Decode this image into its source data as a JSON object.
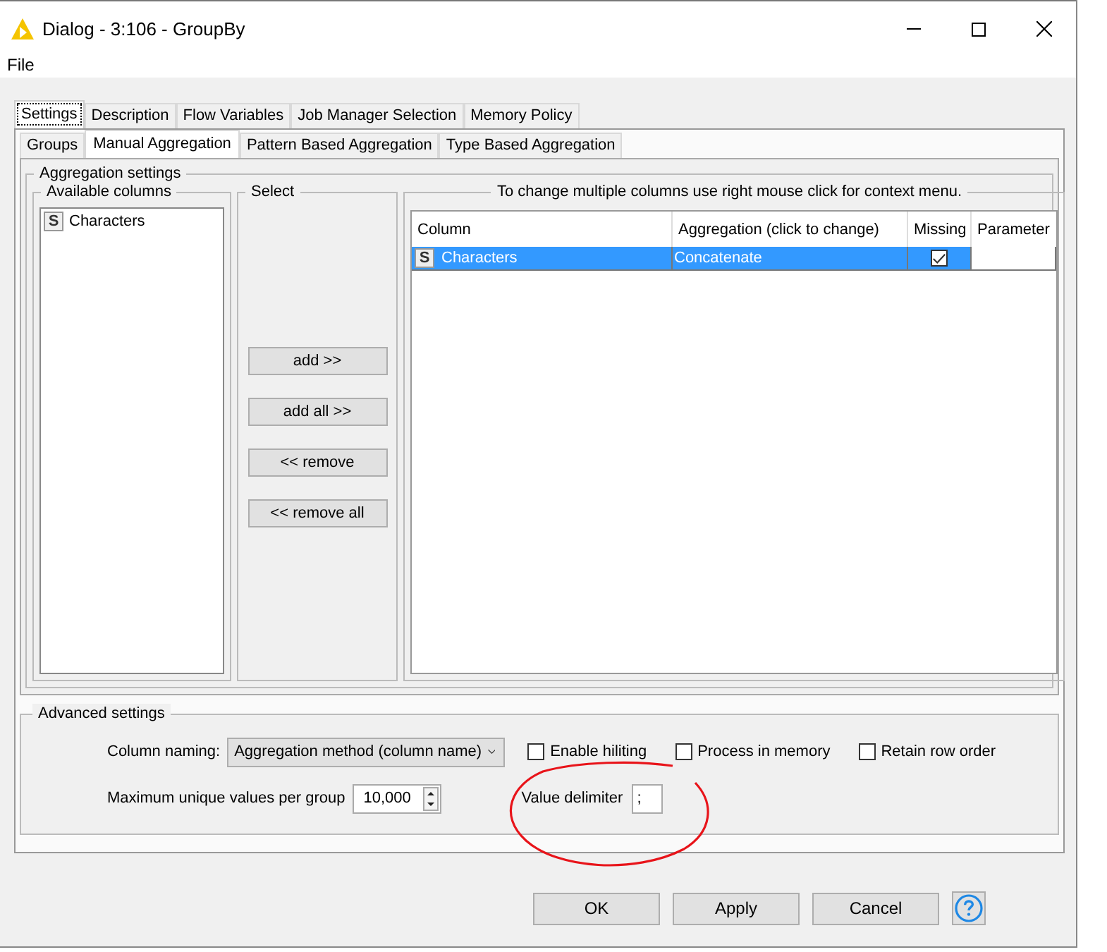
{
  "window": {
    "title": "Dialog - 3:106 - GroupBy"
  },
  "menu": [
    "File"
  ],
  "tabs": [
    {
      "label": "Settings",
      "selected": true
    },
    {
      "label": "Description",
      "selected": false
    },
    {
      "label": "Flow Variables",
      "selected": false
    },
    {
      "label": "Job Manager Selection",
      "selected": false
    },
    {
      "label": "Memory Policy",
      "selected": false
    }
  ],
  "subtabs": [
    {
      "label": "Groups",
      "selected": false
    },
    {
      "label": "Manual Aggregation",
      "selected": true
    },
    {
      "label": "Pattern Based Aggregation",
      "selected": false
    },
    {
      "label": "Type Based Aggregation",
      "selected": false
    }
  ],
  "aggregation_settings": {
    "title": "Aggregation settings",
    "available_columns": {
      "title": "Available columns",
      "items": [
        {
          "type": "S",
          "name": "Characters"
        }
      ]
    },
    "select": {
      "title": "Select",
      "buttons": [
        "add >>",
        "add all >>",
        "<< remove",
        "<< remove all"
      ]
    },
    "aggregations": {
      "title": "To change multiple columns use right mouse click for context menu.",
      "columns": [
        "Column",
        "Aggregation (click to change)",
        "Missing",
        "Parameter"
      ],
      "rows": [
        {
          "type": "S",
          "column": "Characters",
          "aggregation": "Concatenate",
          "missing": true,
          "selected": true
        }
      ]
    }
  },
  "advanced_settings": {
    "title": "Advanced settings",
    "column_naming": {
      "label": "Column naming:",
      "value": "Aggregation method (column name)"
    },
    "checkboxes": [
      {
        "label": "Enable hiliting",
        "checked": false
      },
      {
        "label": "Process in memory",
        "checked": false
      },
      {
        "label": "Retain row order",
        "checked": false
      }
    ],
    "max_unique": {
      "label": "Maximum unique values per group",
      "value": "10,000"
    },
    "value_delimiter": {
      "label": "Value delimiter",
      "value": ";"
    }
  },
  "buttons": [
    "OK",
    "Apply",
    "Cancel"
  ]
}
